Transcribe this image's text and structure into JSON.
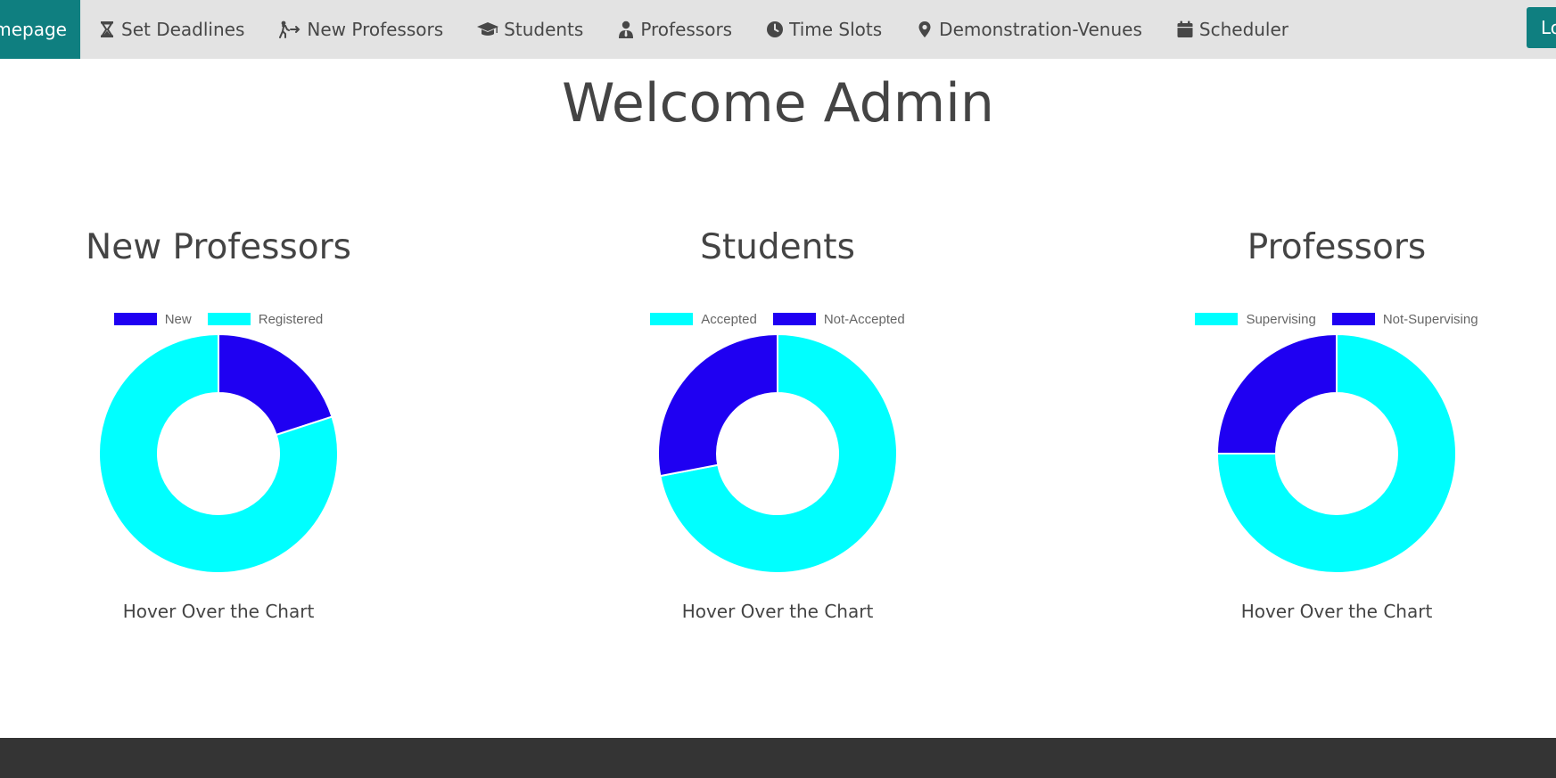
{
  "nav": {
    "home_label": "omepage",
    "logout_label": "Lo",
    "items": [
      {
        "label": "Set Deadlines",
        "icon": "hourglass-icon"
      },
      {
        "label": "New Professors",
        "icon": "person-arrow-icon"
      },
      {
        "label": "Students",
        "icon": "graduation-cap-icon"
      },
      {
        "label": "Professors",
        "icon": "user-tie-icon"
      },
      {
        "label": "Time Slots",
        "icon": "clock-icon"
      },
      {
        "label": "Demonstration-Venues",
        "icon": "map-pin-icon"
      },
      {
        "label": "Scheduler",
        "icon": "calendar-icon"
      }
    ]
  },
  "welcome": "Welcome Admin",
  "colors": {
    "brand": "#0f7f80",
    "cyan": "#00ffff",
    "blue": "#1f00f2",
    "footer": "#343434"
  },
  "charts": [
    {
      "title": "New Professors",
      "hint": "Hover Over the Chart"
    },
    {
      "title": "Students",
      "hint": "Hover Over the Chart"
    },
    {
      "title": "Professors",
      "hint": "Hover Over the Chart"
    }
  ],
  "chart_data": [
    {
      "type": "pie",
      "title": "New Professors",
      "labels": [
        "New",
        "Registered"
      ],
      "values": [
        20,
        80
      ],
      "colors": [
        "#1f00f2",
        "#00ffff"
      ],
      "legend": "top"
    },
    {
      "type": "pie",
      "title": "Students",
      "labels": [
        "Accepted",
        "Not-Accepted"
      ],
      "values": [
        72,
        28
      ],
      "colors": [
        "#00ffff",
        "#1f00f2"
      ],
      "legend": "top"
    },
    {
      "type": "pie",
      "title": "Professors",
      "labels": [
        "Supervising",
        "Not-Supervising"
      ],
      "values": [
        75,
        25
      ],
      "colors": [
        "#00ffff",
        "#1f00f2"
      ],
      "legend": "top"
    }
  ]
}
